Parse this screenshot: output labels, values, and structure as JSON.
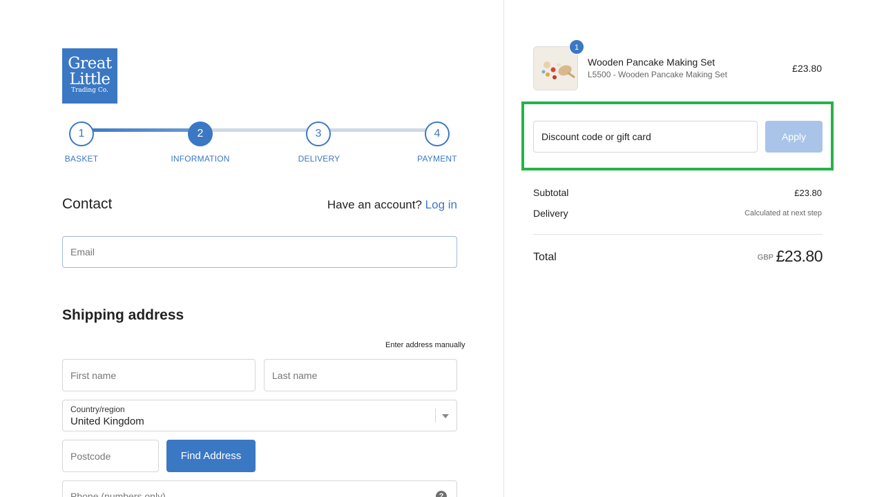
{
  "brand": {
    "logo_line1": "Great",
    "logo_line2": "Little",
    "logo_line3": "Trading Co.",
    "color": "#3b78c4"
  },
  "steps": [
    {
      "number": "1",
      "label": "BASKET",
      "state": "done"
    },
    {
      "number": "2",
      "label": "INFORMATION",
      "state": "active"
    },
    {
      "number": "3",
      "label": "DELIVERY",
      "state": "todo"
    },
    {
      "number": "4",
      "label": "PAYMENT",
      "state": "todo"
    }
  ],
  "contact": {
    "heading": "Contact",
    "account_prompt": "Have an account?",
    "login_link": "Log in",
    "email_placeholder": "Email"
  },
  "shipping": {
    "heading": "Shipping address",
    "manual_link": "Enter address manually",
    "first_name_placeholder": "First name",
    "last_name_placeholder": "Last name",
    "country_label": "Country/region",
    "country_value": "United Kingdom",
    "postcode_placeholder": "Postcode",
    "find_address_label": "Find Address",
    "phone_placeholder": "Phone (numbers only)",
    "help_glyph": "?"
  },
  "order": {
    "item": {
      "quantity": "1",
      "name": "Wooden Pancake Making Set",
      "sku": "L5500 - Wooden Pancake Making Set",
      "price": "£23.80"
    },
    "discount": {
      "placeholder": "Discount code or gift card",
      "apply_label": "Apply",
      "highlight_color": "#27b24a"
    },
    "subtotal_label": "Subtotal",
    "subtotal_value": "£23.80",
    "delivery_label": "Delivery",
    "delivery_value": "Calculated at next step",
    "total_label": "Total",
    "currency": "GBP",
    "total_value": "£23.80"
  }
}
